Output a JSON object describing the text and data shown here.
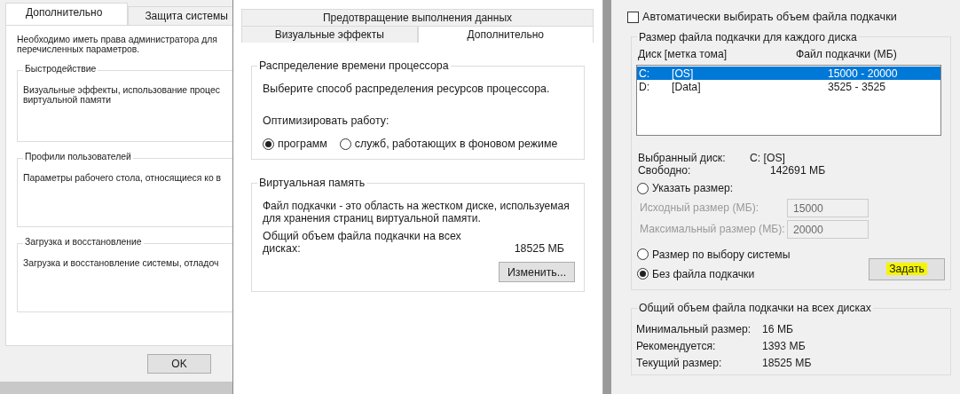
{
  "left_window": {
    "tabs": [
      {
        "label": "Дополнительно",
        "selected": true
      },
      {
        "label": "Защита системы",
        "selected": false
      }
    ],
    "notice": "Необходимо иметь права администратора для\nперечисленных параметров.",
    "groups": [
      {
        "title": "Быстродействие",
        "text": "Визуальные эффекты, использование процес\nвиртуальной памяти"
      },
      {
        "title": "Профили пользователей",
        "text": "Параметры рабочего стола, относящиеся ко в"
      },
      {
        "title": "Загрузка и восстановление",
        "text": "Загрузка и восстановление системы, отладоч"
      }
    ],
    "buttons": [
      "OK"
    ]
  },
  "middle_window": {
    "tab_rows": [
      [
        {
          "label": "Предотвращение выполнения данных",
          "selected": false
        }
      ],
      [
        {
          "label": "Визуальные эффекты",
          "selected": false
        },
        {
          "label": "Дополнительно",
          "selected": true
        }
      ]
    ],
    "cpu_group": {
      "title": "Распределение времени процессора",
      "description": "Выберите способ распределения ресурсов процессора.",
      "optimize_label": "Оптимизировать работу:",
      "options": [
        {
          "label": "программ",
          "selected": true
        },
        {
          "label": "служб, работающих в фоновом режиме",
          "selected": false
        }
      ]
    },
    "vm_group": {
      "title": "Виртуальная память",
      "description": "Файл подкачки - это область на жестком диске, используемая\nдля хранения страниц виртуальной памяти.",
      "total_label": "Общий объем файла подкачки на всех\nдисках:",
      "total_value": "18525 МБ",
      "button": "Изменить..."
    }
  },
  "right_window": {
    "auto_checkbox": {
      "label": "Автоматически выбирать объем файла подкачки",
      "checked": false
    },
    "drive_group": {
      "title": "Размер файла подкачки для каждого диска",
      "columns": [
        "Диск [метка тома]",
        "Файл подкачки (МБ)"
      ],
      "rows": [
        {
          "drive": "C:",
          "label": "[OS]",
          "size": "15000 - 20000",
          "selected": true
        },
        {
          "drive": "D:",
          "label": "[Data]",
          "size": "3525 - 3525",
          "selected": false
        }
      ],
      "selected_drive_label": "Выбранный диск:",
      "selected_drive_value": "C:  [OS]",
      "free_label": "Свободно:",
      "free_value": "142691 МБ",
      "size_options": [
        {
          "label": "Указать размер:",
          "selected": false,
          "fields": [
            {
              "label": "Исходный размер (МБ):",
              "value": "15000",
              "disabled": true
            },
            {
              "label": "Максимальный размер (МБ):",
              "value": "20000",
              "disabled": true
            }
          ]
        },
        {
          "label": "Размер по выбору системы",
          "selected": false
        },
        {
          "label": "Без файла подкачки",
          "selected": true
        }
      ],
      "set_button": {
        "label": "Задать",
        "highlighted": true
      }
    },
    "totals_group": {
      "title": "Общий объем файла подкачки на всех дисках",
      "rows": [
        {
          "label": "Минимальный размер:",
          "value": "16 МБ"
        },
        {
          "label": "Рекомендуется:",
          "value": "1393 МБ"
        },
        {
          "label": "Текущий размер:",
          "value": "18525 МБ"
        }
      ]
    }
  }
}
